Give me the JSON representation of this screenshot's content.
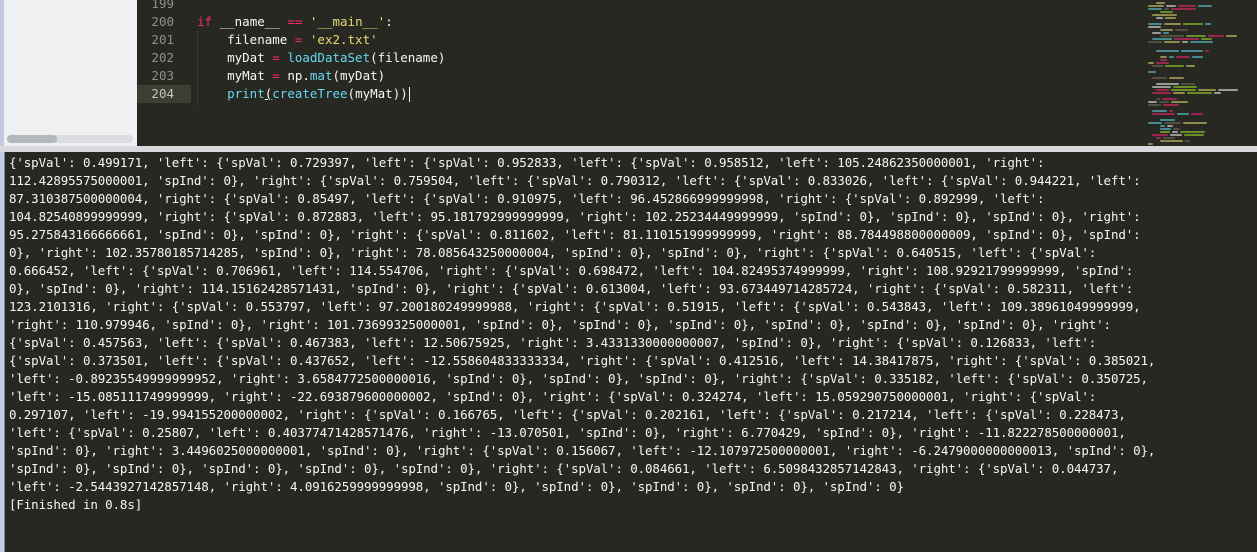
{
  "editor": {
    "line_numbers": [
      "199",
      "200",
      "201",
      "202",
      "203",
      "204"
    ],
    "active_line": "204",
    "lines": {
      "l200": {
        "kw": "if",
        "name": " __name__ ",
        "op": "==",
        "sp": " ",
        "str": "'__main__'",
        "colon": ":"
      },
      "l201": {
        "indent": "    ",
        "var": "filename",
        "eq": " = ",
        "str": "'ex2.txt'"
      },
      "l202": {
        "indent": "    ",
        "var": "myDat",
        "eq": " = ",
        "fn": "loadDataSet",
        "args": "(filename)"
      },
      "l203": {
        "indent": "    ",
        "var": "myMat",
        "eq": " = ",
        "mod": "np.",
        "fn": "mat",
        "args": "(myDat)"
      },
      "l204": {
        "indent": "    ",
        "fn1": "print",
        "open": "(",
        "fn2": "createTree",
        "args": "(myMat))"
      }
    }
  },
  "console": {
    "output_lines": [
      "{'spVal': 0.499171, 'left': {'spVal': 0.729397, 'left': {'spVal': 0.952833, 'left': {'spVal': 0.958512, 'left': 105.24862350000001, 'right':",
      "112.42895575000001, 'spInd': 0}, 'right': {'spVal': 0.759504, 'left': {'spVal': 0.790312, 'left': {'spVal': 0.833026, 'left': {'spVal': 0.944221, 'left':",
      "87.310387500000004, 'right': {'spVal': 0.85497, 'left': {'spVal': 0.910975, 'left': 96.452866999999998, 'right': {'spVal': 0.892999, 'left':",
      "104.82540899999999, 'right': {'spVal': 0.872883, 'left': 95.181792999999999, 'right': 102.25234449999999, 'spInd': 0}, 'spInd': 0}, 'spInd': 0}, 'right':",
      "95.275843166666661, 'spInd': 0}, 'spInd': 0}, 'right': {'spVal': 0.811602, 'left': 81.110151999999999, 'right': 88.784498800000009, 'spInd': 0}, 'spInd':",
      "0}, 'right': 102.35780185714285, 'spInd': 0}, 'right': 78.085643250000004, 'spInd': 0}, 'spInd': 0}, 'right': {'spVal': 0.640515, 'left': {'spVal':",
      "0.666452, 'left': {'spVal': 0.706961, 'left': 114.554706, 'right': {'spVal': 0.698472, 'left': 104.82495374999999, 'right': 108.92921799999999, 'spInd':",
      "0}, 'spInd': 0}, 'right': 114.15162428571431, 'spInd': 0}, 'right': {'spVal': 0.613004, 'left': 93.673449714285724, 'right': {'spVal': 0.582311, 'left':",
      "123.2101316, 'right': {'spVal': 0.553797, 'left': 97.200180249999988, 'right': {'spVal': 0.51915, 'left': {'spVal': 0.543843, 'left': 109.38961049999999,",
      "'right': 110.979946, 'spInd': 0}, 'right': 101.73699325000001, 'spInd': 0}, 'spInd': 0}, 'spInd': 0}, 'spInd': 0}, 'spInd': 0}, 'spInd': 0}, 'right':",
      "{'spVal': 0.457563, 'left': {'spVal': 0.467383, 'left': 12.50675925, 'right': 3.4331330000000007, 'spInd': 0}, 'right': {'spVal': 0.126833, 'left':",
      "{'spVal': 0.373501, 'left': {'spVal': 0.437652, 'left': -12.558604833333334, 'right': {'spVal': 0.412516, 'left': 14.38417875, 'right': {'spVal': 0.385021,",
      "'left': -0.89235549999999952, 'right': 3.6584772500000016, 'spInd': 0}, 'spInd': 0}, 'spInd': 0}, 'right': {'spVal': 0.335182, 'left': {'spVal': 0.350725,",
      "'left': -15.085111749999999, 'right': -22.693879600000002, 'spInd': 0}, 'right': {'spVal': 0.324274, 'left': 15.059290750000001, 'right': {'spVal':",
      "0.297107, 'left': -19.994155200000002, 'right': {'spVal': 0.166765, 'left': {'spVal': 0.202161, 'left': {'spVal': 0.217214, 'left': {'spVal': 0.228473,",
      "'left': {'spVal': 0.25807, 'left': 0.40377471428571476, 'right': -13.070501, 'spInd': 0}, 'right': 6.770429, 'spInd': 0}, 'right': -11.822278500000001,",
      "'spInd': 0}, 'right': 3.4496025000000001, 'spInd': 0}, 'right': {'spVal': 0.156067, 'left': -12.107972500000001, 'right': -6.2479000000000013, 'spInd': 0},",
      "'spInd': 0}, 'spInd': 0}, 'spInd': 0}, 'spInd': 0}, 'spInd': 0}, 'right': {'spVal': 0.084661, 'left': 6.5098432857142843, 'right': {'spVal': 0.044737,",
      "'left': -2.5443927142857148, 'right': 4.0916259999999998, 'spInd': 0}, 'spInd': 0}, 'spInd': 0}, 'spInd': 0}, 'spInd': 0}",
      "[Finished in 0.8s]"
    ]
  },
  "colors": {
    "editor_bg": "#272822",
    "keyword": "#f92672",
    "string": "#e6db74",
    "function": "#66d9ef",
    "text": "#f8f8f2",
    "line_number": "#8f908a"
  }
}
